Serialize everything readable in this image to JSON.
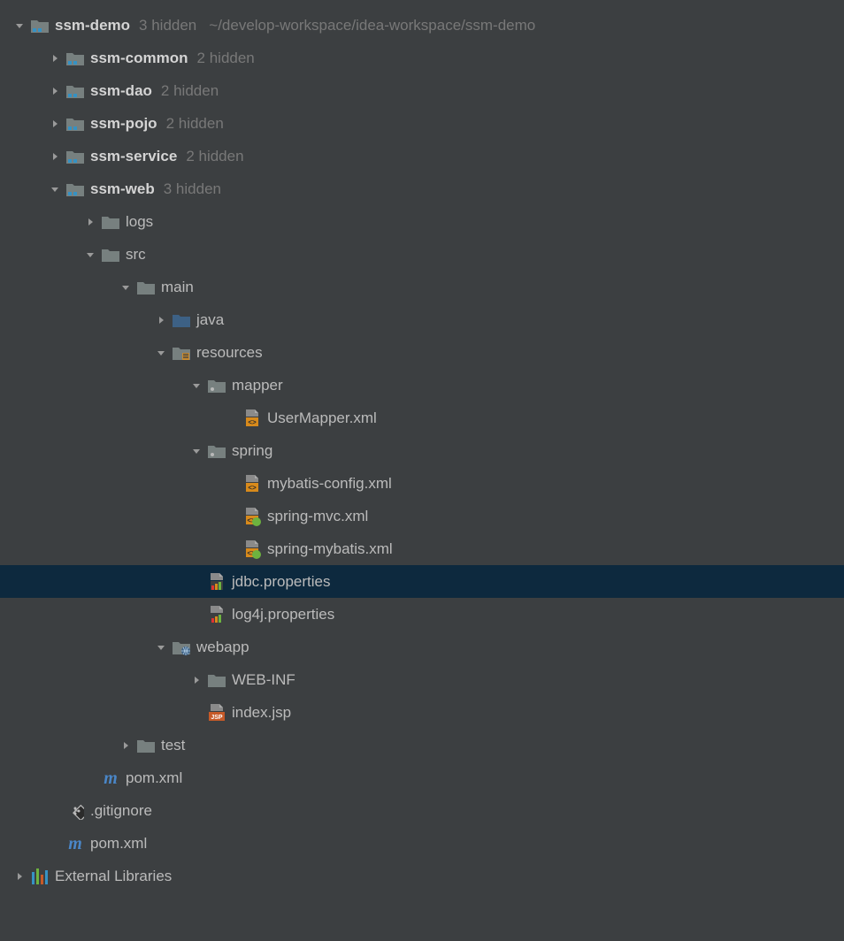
{
  "root": {
    "name": "ssm-demo",
    "hint": "3 hidden",
    "path": "~/develop-workspace/idea-workspace/ssm-demo"
  },
  "modules": {
    "common": {
      "name": "ssm-common",
      "hint": "2 hidden"
    },
    "dao": {
      "name": "ssm-dao",
      "hint": "2 hidden"
    },
    "pojo": {
      "name": "ssm-pojo",
      "hint": "2 hidden"
    },
    "service": {
      "name": "ssm-service",
      "hint": "2 hidden"
    },
    "web": {
      "name": "ssm-web",
      "hint": "3 hidden"
    }
  },
  "web": {
    "logs": "logs",
    "src": "src",
    "main": "main",
    "java": "java",
    "resources": "resources",
    "mapper": "mapper",
    "userMapperXml": "UserMapper.xml",
    "spring": "spring",
    "mybatisConfigXml": "mybatis-config.xml",
    "springMvcXml": "spring-mvc.xml",
    "springMybatisXml": "spring-mybatis.xml",
    "jdbcProperties": "jdbc.properties",
    "log4jProperties": "log4j.properties",
    "webapp": "webapp",
    "webInf": "WEB-INF",
    "indexJsp": "index.jsp",
    "test": "test",
    "pomXml": "pom.xml"
  },
  "gitignore": ".gitignore",
  "rootPom": "pom.xml",
  "externalLibraries": "External Libraries"
}
